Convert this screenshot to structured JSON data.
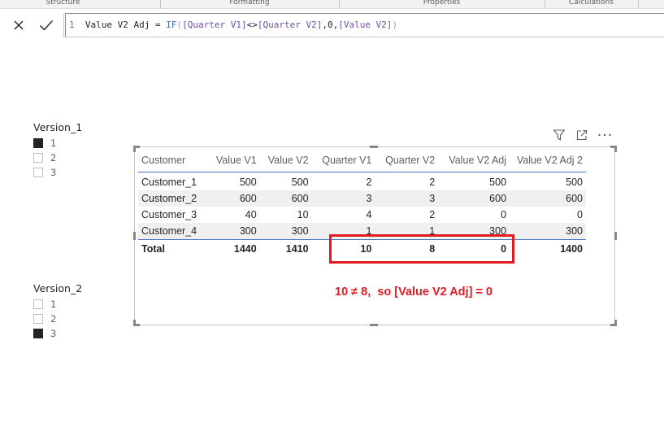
{
  "ribbon": {
    "tabs": [
      "Structure",
      "Formatting",
      "Properties",
      "Calculations"
    ]
  },
  "formula_bar": {
    "line_number": "1",
    "measure_name": "Value V2 Adj",
    "equals": " = ",
    "function": "IF",
    "open_paren": "(",
    "ref1": "[Quarter V1]",
    "operator": "<>",
    "ref2": "[Quarter V2]",
    "literal": ",0,",
    "ref3": "[Value V2]",
    "close_paren": ")",
    "cancel_icon": "close-icon",
    "commit_icon": "checkmark-icon"
  },
  "slicer1": {
    "title": "Version_1",
    "options": [
      {
        "label": "1",
        "checked": true
      },
      {
        "label": "2",
        "checked": false
      },
      {
        "label": "3",
        "checked": false
      }
    ]
  },
  "slicer2": {
    "title": "Version_2",
    "options": [
      {
        "label": "1",
        "checked": false
      },
      {
        "label": "2",
        "checked": false
      },
      {
        "label": "3",
        "checked": true
      }
    ]
  },
  "visual_header": {
    "icons": [
      "filter-icon",
      "focus-mode-icon",
      "more-options-icon"
    ]
  },
  "table": {
    "columns": [
      "Customer",
      "Value V1",
      "Value V2",
      "Quarter V1",
      "Quarter V2",
      "Value V2 Adj",
      "Value V2 Adj 2"
    ],
    "rows": [
      [
        "Customer_1",
        "500",
        "500",
        "2",
        "2",
        "500",
        "500"
      ],
      [
        "Customer_2",
        "600",
        "600",
        "3",
        "3",
        "600",
        "600"
      ],
      [
        "Customer_3",
        "40",
        "10",
        "4",
        "2",
        "0",
        "0"
      ],
      [
        "Customer_4",
        "300",
        "300",
        "1",
        "1",
        "300",
        "300"
      ]
    ],
    "total": [
      "Total",
      "1440",
      "1410",
      "10",
      "8",
      "0",
      "1400"
    ]
  },
  "annotation": {
    "text": "10 ≠ 8,  so [Value V2 Adj] = 0",
    "color": "#e01c22"
  },
  "colors": {
    "accent": "#4c7cc0",
    "highlight": "#e01c22",
    "row_alt": "#f0f0f0"
  }
}
